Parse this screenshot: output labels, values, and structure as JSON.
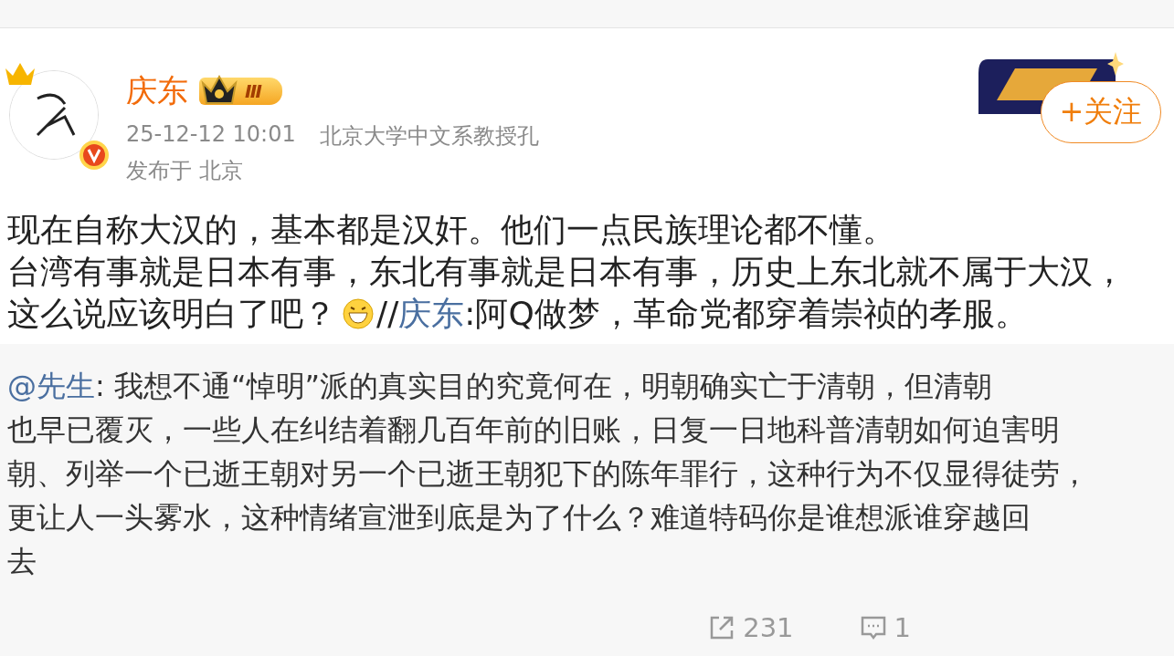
{
  "post": {
    "author": "庆东",
    "level_badge": "Ⅲ",
    "time": "25-12-12 10:01",
    "source": "北京大学中文系教授孔",
    "location": "发布于 北京",
    "follow_button": "+关注",
    "body_lines": [
      [
        {
          "text": "现在自称大汉的，基本都是汉奸。他们一点民族理论都不懂。",
          "kind": "plain"
        }
      ],
      [
        {
          "text": "台湾有事就是日本有事，东北有事就是日本有事，历史上东北就不属于大汉，",
          "kind": "plain"
        }
      ],
      [
        {
          "text": "这么说应该明白了吧？",
          "kind": "plain"
        },
        {
          "kind": "emoji"
        },
        {
          "text": "//",
          "kind": "plain"
        },
        {
          "text": "庆东",
          "kind": "link"
        },
        {
          "text": ":阿Q做梦，革命党都穿着崇祯的孝服。",
          "kind": "plain"
        }
      ]
    ]
  },
  "quote": {
    "lines": [
      [
        {
          "text": "@",
          "kind": "link"
        },
        {
          "text": "先生",
          "kind": "link"
        },
        {
          "text": ": 我想不通“悼明”派的真实目的究竟何在，明朝确实亡于清朝，但清朝",
          "kind": "plain"
        }
      ],
      [
        {
          "text": "也早已覆灭，一些人在纠结着翻几百年前的旧账，日复一日地科普清朝如何迫害明",
          "kind": "plain"
        }
      ],
      [
        {
          "text": "朝、列举一个已逝王朝对另一个已逝王朝犯下的陈年罪行，这种行为不仅显得徒劳，",
          "kind": "plain"
        }
      ],
      [
        {
          "text": "更让人一头雾水，这种情绪宣泄到底是为了什么？难道特码你是谁想派谁穿越回",
          "kind": "plain"
        }
      ],
      [
        {
          "text": "去",
          "kind": "plain"
        }
      ]
    ],
    "actions": [
      {
        "kind": "repost",
        "count": "231"
      },
      {
        "kind": "comment",
        "count": "1"
      }
    ]
  }
}
